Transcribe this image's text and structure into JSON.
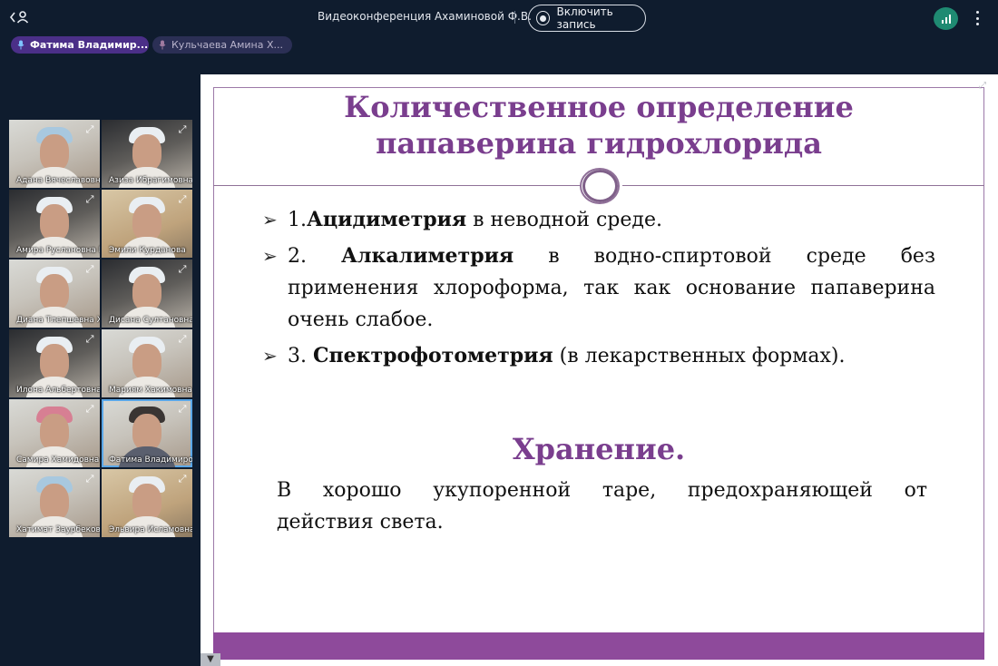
{
  "header": {
    "title": "Видеоконференция Ахаминовой Ф.В.",
    "record_label": "Включить запись"
  },
  "speakers": [
    {
      "name": "Фатима Владимир...",
      "active": true
    },
    {
      "name": "Кульчаева Амина Х...",
      "active": false
    }
  ],
  "participants": [
    {
      "name": "Адана Вячеславовна Х",
      "style": "blue"
    },
    {
      "name": "Азиза Ибрагимовна Б",
      "style": "dark"
    },
    {
      "name": "Амира Руслановна Г",
      "style": "dark"
    },
    {
      "name": "Эмили Курданова",
      "style": "warm"
    },
    {
      "name": "Диана Тлепшевна Ха",
      "style": "light"
    },
    {
      "name": "Дисана Султановна Т",
      "style": "dark"
    },
    {
      "name": "Илона Альбертовна",
      "style": "dark"
    },
    {
      "name": "Мариям Хакимовна Т",
      "style": "light"
    },
    {
      "name": "Самира Хамидовна Г",
      "style": "pink"
    },
    {
      "name": "Фатима Владимиров",
      "style": "active"
    },
    {
      "name": "Хатимат Заурбекови",
      "style": "blue"
    },
    {
      "name": "Эльвира Исламовна",
      "style": "warm"
    }
  ],
  "slide": {
    "title_line1": "Количественное определение",
    "title_line2": "папаверина гидрохлорида",
    "bullet_marker": "➢",
    "bullet1_prefix": "1.",
    "bullet1_bold": "Ацидиметрия",
    "bullet1_rest": " в неводной среде.",
    "bullet2_num": "2.",
    "bullet2_bold": "Алкалиметрия",
    "bullet2_w1": "в",
    "bullet2_w2": "водно-спиртовой",
    "bullet2_w3": "среде",
    "bullet2_w4": "без",
    "bullet2_rest": "применения хлороформа, так как основание папаверина очень слабое.",
    "bullet3_prefix": "3. ",
    "bullet3_bold": "Спектрофотометрия",
    "bullet3_rest": " (в лекарственных формах).",
    "storage_title": "Хранение.",
    "storage_w1": "В",
    "storage_w2": "хорошо",
    "storage_w3": "укупоренной",
    "storage_w4": "таре,",
    "storage_w5": "предохраняющей",
    "storage_w6": "от",
    "storage_line2": "действия света."
  },
  "colors": {
    "accent": "#7a3e8e",
    "band": "#8e4a9b",
    "background": "#0f1c2e",
    "speaker_chip": "#4b2f88",
    "signal": "#1f8a72"
  },
  "icons": {
    "back": "back-user-icon",
    "record": "record-icon",
    "signal": "signal-icon",
    "more": "more-vertical-icon",
    "mic": "mic-icon",
    "expand": "expand-icon"
  }
}
